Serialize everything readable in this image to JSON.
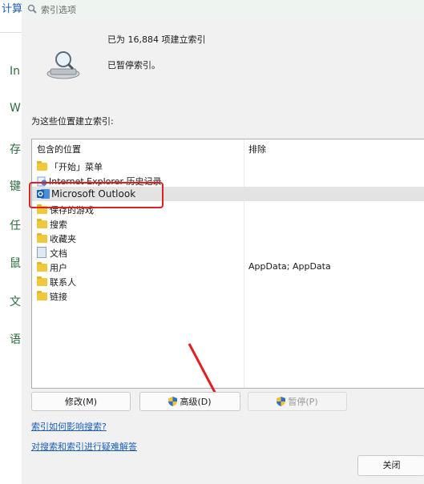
{
  "background": {
    "top_text": "计算",
    "items": [
      "In",
      "W",
      "存",
      "键",
      "任",
      "鼠",
      "文",
      "语"
    ]
  },
  "dialog": {
    "title": "索引选项",
    "status_count": "已为 16,884 项建立索引",
    "status_state": "已暂停索引。",
    "locations_label": "为这些位置建立索引:",
    "columns": {
      "included": "包含的位置",
      "excluded": "排除"
    },
    "rows": [
      {
        "name": "「开始」菜单",
        "icon": "folder-icon",
        "exclude": ""
      },
      {
        "name": "Internet Explorer 历史记录",
        "icon": "ie-history-icon",
        "exclude": ""
      },
      {
        "name": "Microsoft Outlook",
        "icon": "outlook-icon",
        "exclude": "",
        "selected": true
      },
      {
        "name": "保存的游戏",
        "icon": "folder-icon",
        "exclude": ""
      },
      {
        "name": "搜索",
        "icon": "folder-icon",
        "exclude": ""
      },
      {
        "name": "收藏夹",
        "icon": "folder-icon",
        "exclude": ""
      },
      {
        "name": "文档",
        "icon": "document-icon",
        "exclude": ""
      },
      {
        "name": "用户",
        "icon": "folder-icon",
        "exclude": "AppData; AppData"
      },
      {
        "name": "联系人",
        "icon": "folder-icon",
        "exclude": ""
      },
      {
        "name": "链接",
        "icon": "folder-icon",
        "exclude": ""
      }
    ],
    "buttons": {
      "modify": "修改(M)",
      "advanced": "高级(D)",
      "pause": "暂停(P)",
      "close": "关闭"
    },
    "links": {
      "how_affects": "索引如何影响搜索?",
      "troubleshoot": "对搜索和索引进行疑难解答"
    },
    "colors": {
      "highlight_box": "#e02020",
      "arrow": "#e02020",
      "link": "#1b5fb4"
    }
  }
}
